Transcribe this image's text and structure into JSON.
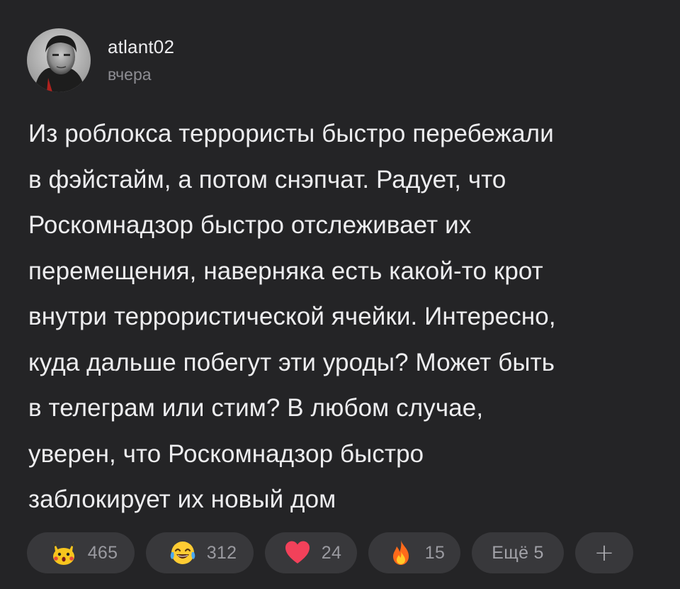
{
  "post": {
    "author": {
      "username": "atlant02",
      "timestamp": "вчера",
      "avatar_icon": "avatar-photo"
    },
    "text_lines": [
      "Из роблокса террористы быстро перебежали",
      "в фэйстайм, а потом снэпчат. Радует, что",
      "Роскомнадзор быстро отслеживает их",
      "перемещения, наверняка есть какой-то крот",
      "внутри террористической ячейки. Интересно,",
      "куда дальше побегут эти уроды? Может быть",
      "в телеграм или стим? В любом случае,",
      "уверен, что Роскомнадзор быстро",
      "заблокирует их новый дом"
    ],
    "reactions": [
      {
        "icon": "pikachu-surprised-icon",
        "count": "465"
      },
      {
        "icon": "tears-of-joy-icon",
        "count": "312"
      },
      {
        "icon": "heart-icon",
        "count": "24"
      },
      {
        "icon": "fire-icon",
        "count": "15"
      }
    ],
    "more_reactions_label": "Ещё 5",
    "add_reaction_label": "+"
  },
  "colors": {
    "background": "#242426",
    "chip_background": "#38383b",
    "text_primary": "#ededef",
    "text_secondary": "#8d8d93",
    "heart": "#f2415a",
    "fire": "#ff7a1a"
  }
}
